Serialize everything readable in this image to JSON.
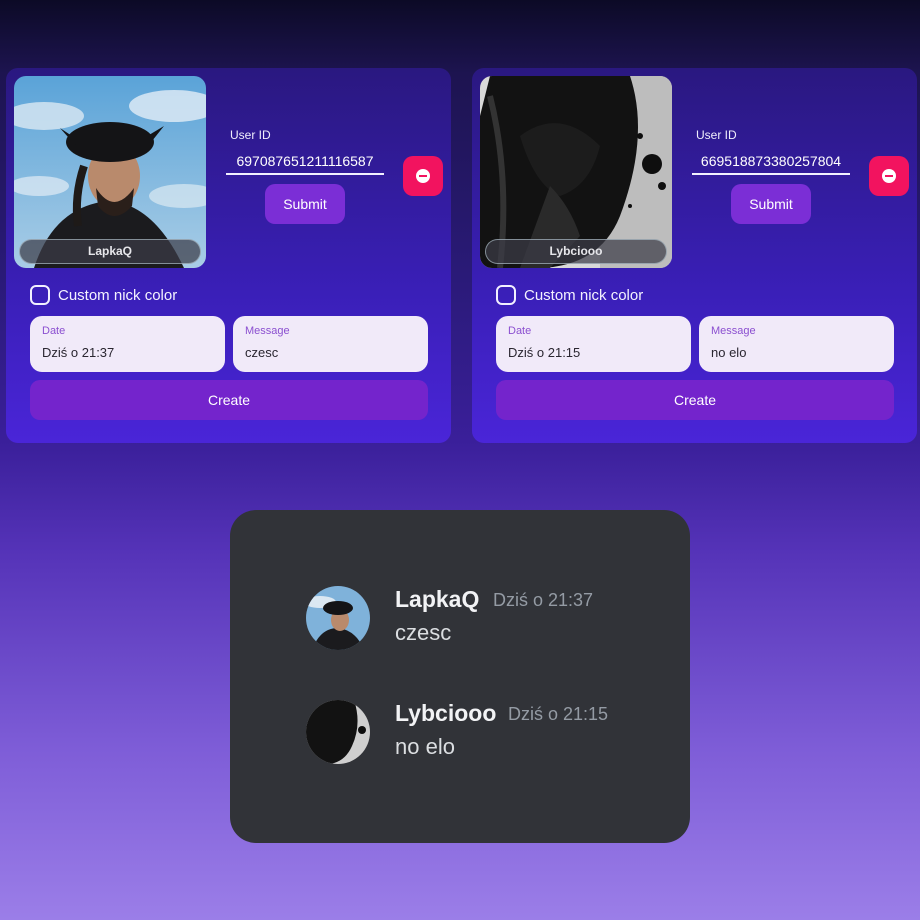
{
  "cards": [
    {
      "username": "LapkaQ",
      "user_id_label": "User ID",
      "user_id_value": "697087651211116587",
      "submit_label": "Submit",
      "remove_icon": "minus-circle-icon",
      "custom_nick_label": "Custom nick color",
      "custom_nick_checked": false,
      "date_label": "Date",
      "date_value": "Dziś o 21:37",
      "message_label": "Message",
      "message_value": "czesc",
      "create_label": "Create"
    },
    {
      "username": "Lybciooo",
      "user_id_label": "User ID",
      "user_id_value": "669518873380257804",
      "submit_label": "Submit",
      "remove_icon": "minus-circle-icon",
      "custom_nick_label": "Custom nick color",
      "custom_nick_checked": false,
      "date_label": "Date",
      "date_value": "Dziś o 21:15",
      "message_label": "Message",
      "message_value": "no elo",
      "create_label": "Create"
    }
  ],
  "preview": {
    "messages": [
      {
        "name": "LapkaQ",
        "time": "Dziś o 21:37",
        "text": "czesc"
      },
      {
        "name": "Lybciooo",
        "time": "Dziś o 21:15",
        "text": "no elo"
      }
    ]
  },
  "colors": {
    "accent": "#7b2ed6",
    "remove": "#f2135f",
    "preview_bg": "#313338"
  }
}
